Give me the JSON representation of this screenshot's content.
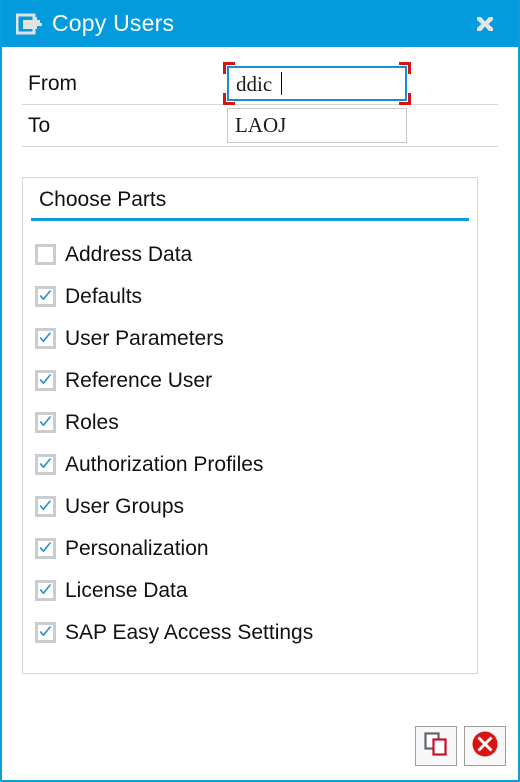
{
  "window": {
    "title": "Copy Users",
    "title_icon": "copy-export-icon",
    "close_icon": "close-icon",
    "accent_color": "#039BDE",
    "border_color": "#0d9ddb"
  },
  "form": {
    "rows": [
      {
        "label": "From",
        "value": "ddic",
        "focused": true
      },
      {
        "label": "To",
        "value": "LAOJ",
        "focused": false
      }
    ]
  },
  "panel": {
    "title": "Choose Parts",
    "underline_color": "#0d9ddb",
    "items": [
      {
        "label": "Address Data",
        "checked": false
      },
      {
        "label": "Defaults",
        "checked": true
      },
      {
        "label": "User Parameters",
        "checked": true
      },
      {
        "label": "Reference User",
        "checked": true
      },
      {
        "label": "Roles",
        "checked": true
      },
      {
        "label": "Authorization Profiles",
        "checked": true
      },
      {
        "label": "User Groups",
        "checked": true
      },
      {
        "label": "Personalization",
        "checked": true
      },
      {
        "label": "License Data",
        "checked": true
      },
      {
        "label": "SAP Easy Access Settings",
        "checked": true
      }
    ],
    "check_color": "#2f8fd0"
  },
  "footer": {
    "buttons": [
      {
        "name": "copy-button",
        "icon": "copy-icon"
      },
      {
        "name": "cancel-button",
        "icon": "cancel-circle-icon"
      }
    ],
    "cancel_color": "#d81313"
  }
}
